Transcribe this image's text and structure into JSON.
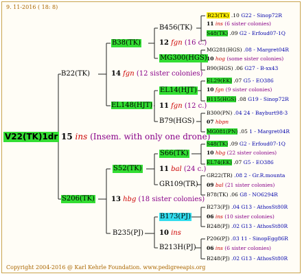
{
  "header": {
    "date": "9. 11-2016 ( 18: 8)"
  },
  "footer": {
    "copyright": "Copyright 2004-2016 @ Karl Kehrle Foundation.   www.pedigreeapis.org"
  },
  "root": {
    "name": "V22(TK)1dr",
    "year": "15",
    "mating": "ins",
    "note": "(Insem. with only one drone)"
  },
  "gen1": {
    "sire": {
      "name": "B22(TK)",
      "year": "14",
      "mating": "fgn",
      "note": "(12 sister colonies)"
    },
    "dam": {
      "name": "S206(TK)",
      "year": "13",
      "mating": "hbg",
      "note": "(18 sister colonies)"
    }
  },
  "gen2": [
    {
      "name": "B38(TK)",
      "year": "12",
      "mating": "fgn",
      "note": "(16 c.)"
    },
    {
      "name": "EL148(HJT)",
      "year": "11",
      "mating": "fgn",
      "note": "(12 c.)"
    },
    {
      "name": "S52(TK)",
      "year": "11",
      "mating": "bal",
      "note": "(24 c.)"
    },
    {
      "name": "B235(PJ)",
      "year": "10",
      "mating": "ins"
    }
  ],
  "gen3": [
    {
      "name": "B456(TK)"
    },
    {
      "name": "MG300(HGS)"
    },
    {
      "name": "EL14(HJT)"
    },
    {
      "name": "B79(HGS)"
    },
    {
      "name": "S66(TK)"
    },
    {
      "name": "GR109(TR)"
    },
    {
      "name": "B173(PJ)"
    },
    {
      "name": "B213H(PJ)"
    }
  ],
  "gen4": [
    {
      "name": "B23(TK)",
      "year": ".10",
      "line": "G22 - Sinop72R"
    },
    {
      "year": "11",
      "mating": "ins",
      "note": "(6 sister colonies)"
    },
    {
      "name": "S48(TK)",
      "year": ".09",
      "line": "G2 - Erfoud07-1Q"
    },
    {
      "name": "MG281(HGS)",
      "line": ".08 - Margret04R"
    },
    {
      "year": "10",
      "mating": "hog",
      "note": "(some sister colonies)"
    },
    {
      "name": "B90(HGS) .06",
      "line": "G27 - B-xx43"
    },
    {
      "name": "EL29(EK)",
      "year": ".07",
      "line": "G5 - EO386"
    },
    {
      "year": "10",
      "mating": "fgn",
      "note": "(9 sister colonies)"
    },
    {
      "name": "B115(HGS)",
      "year": ".08",
      "line": "G19 - Sinop72R"
    },
    {
      "name": "B300(PN)",
      "line": ".04 24 - Bayburt98-3"
    },
    {
      "year": "07",
      "mating": "hbpn"
    },
    {
      "name": "MG081(PN)",
      "year": ".05",
      "line": "1 - Margret04R"
    },
    {
      "name": "S48(TK)",
      "year": ".09",
      "line": "G2 - Erfoud07-1Q"
    },
    {
      "year": "10",
      "mating": "hbg",
      "note": "(22 sister colonies)"
    },
    {
      "name": "EL74(EK)",
      "year": ".07",
      "line": "G5 - EO386"
    },
    {
      "name": "GR22(TR)",
      "line": ".08 2 - Gr.R.mounta"
    },
    {
      "year": "09",
      "mating": "bal",
      "note": "(21 sister colonies)"
    },
    {
      "name": "B78(TK)",
      "year": ".06",
      "line": "G8 - NO6294R"
    },
    {
      "name": "B273(PJ)",
      "line": ".04 G13 - AthosSt80R"
    },
    {
      "year": "06",
      "mating": "ins",
      "note": "(10 sister colonies)"
    },
    {
      "name": "B248(PJ)",
      "line": ".02 G13 - AthosSt80R"
    },
    {
      "name": "P206(PJ)",
      "line": ".03 11 - SinopEgg86R"
    },
    {
      "year": "06",
      "mating": "ins",
      "note": "(6 sister colonies)"
    },
    {
      "name": "B248(PJ)",
      "line": ".02 G13 - AthosSt80R"
    }
  ]
}
